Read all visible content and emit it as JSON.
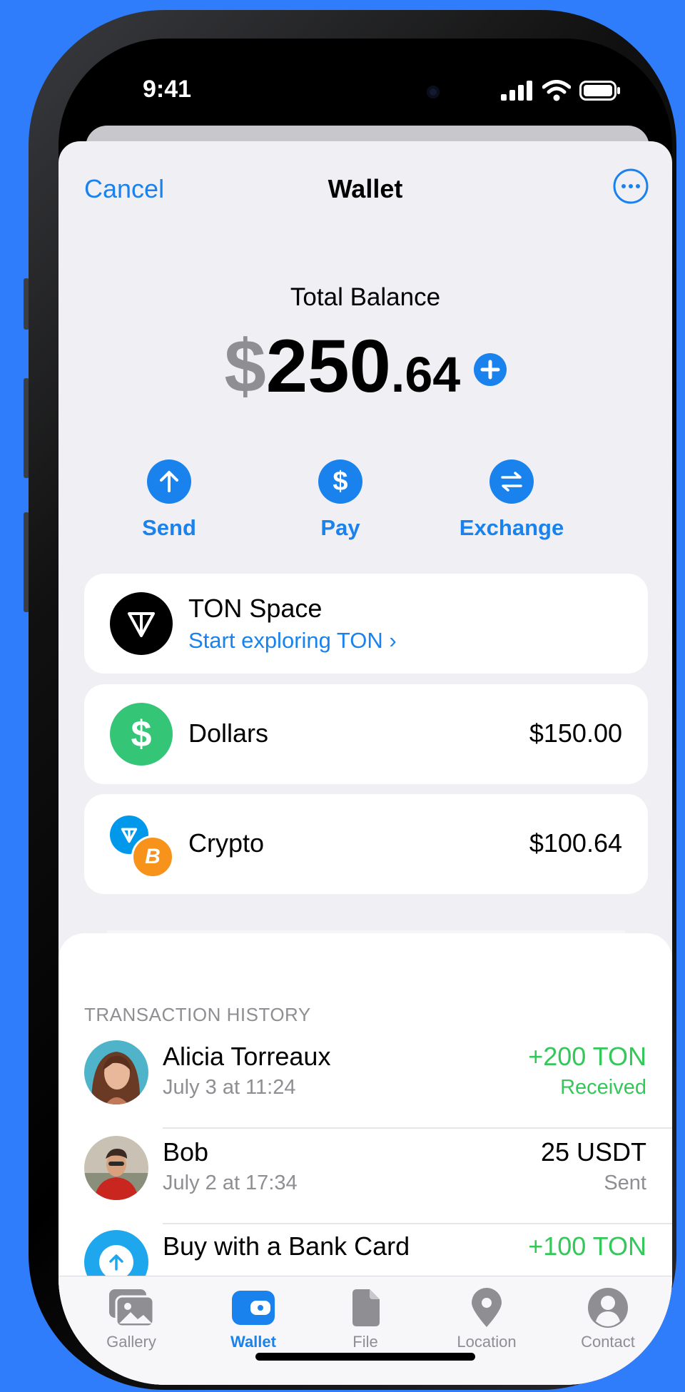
{
  "status_bar": {
    "time": "9:41"
  },
  "nav": {
    "cancel": "Cancel",
    "title": "Wallet"
  },
  "balance": {
    "label": "Total Balance",
    "currency": "$",
    "whole": "250",
    "fraction": ".64"
  },
  "actions": [
    {
      "label": "Send",
      "icon": "arrow-up-icon"
    },
    {
      "label": "Pay",
      "icon": "dollar-icon"
    },
    {
      "label": "Exchange",
      "icon": "exchange-icon"
    }
  ],
  "ton_space": {
    "title": "TON Space",
    "link": "Start exploring TON ›"
  },
  "accounts": [
    {
      "name": "Dollars",
      "amount": "$150.00"
    },
    {
      "name": "Crypto",
      "amount": "$100.64"
    }
  ],
  "history": {
    "header": "TRANSACTION HISTORY",
    "items": [
      {
        "name": "Alicia Torreaux",
        "date": "July 3 at 11:24",
        "amount": "+200 TON",
        "status": "Received"
      },
      {
        "name": "Bob",
        "date": "July 2 at 17:34",
        "amount": "25 USDT",
        "status": "Sent"
      },
      {
        "name": "Buy with a Bank Card",
        "amount": "+100 TON"
      }
    ]
  },
  "tabs": [
    {
      "label": "Gallery",
      "icon": "gallery-icon"
    },
    {
      "label": "Wallet",
      "icon": "wallet-icon",
      "active": true
    },
    {
      "label": "File",
      "icon": "file-icon"
    },
    {
      "label": "Location",
      "icon": "location-icon"
    },
    {
      "label": "Contact",
      "icon": "contact-icon"
    }
  ],
  "colors": {
    "accent": "#1a82ed",
    "positive": "#34c759",
    "background": "#2f7dfa",
    "dollars": "#34c577",
    "bitcoin": "#f7931a",
    "ton": "#0098ea"
  }
}
